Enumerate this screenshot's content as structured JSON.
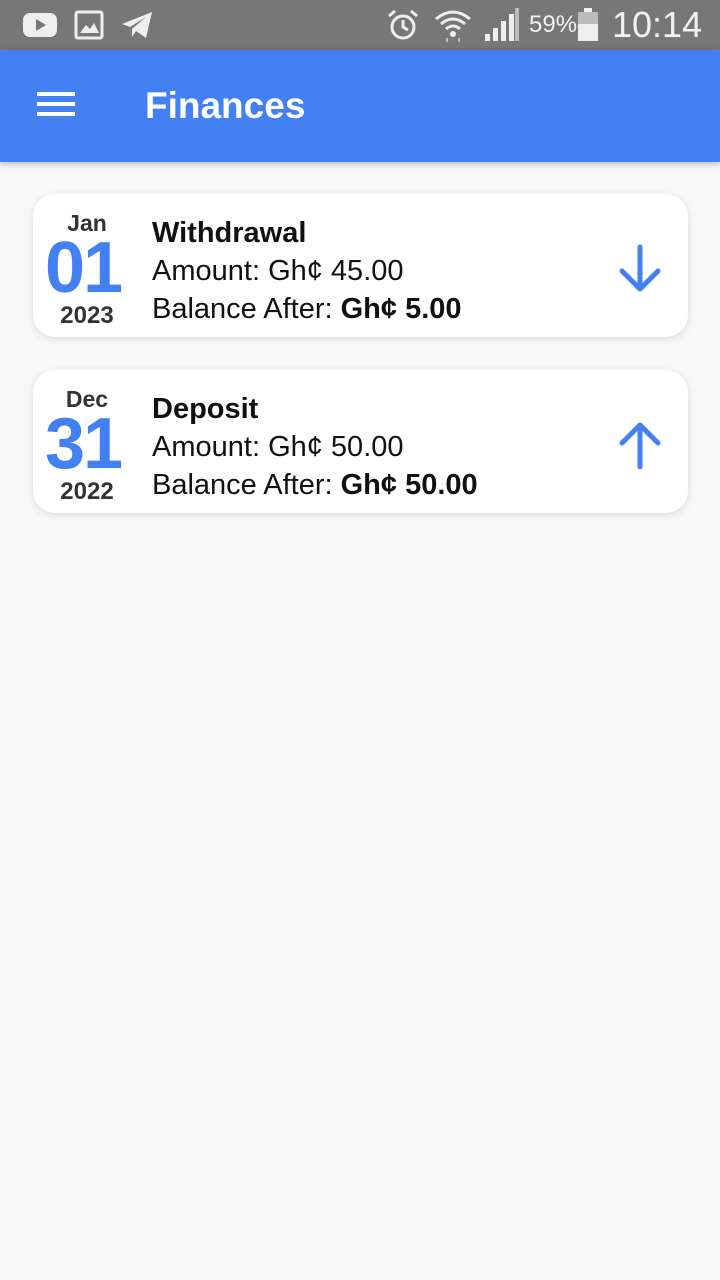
{
  "status_bar": {
    "icons_left": [
      "youtube-icon",
      "image-icon",
      "telegram-icon"
    ],
    "icons_right": [
      "alarm-icon",
      "wifi-icon",
      "signal-icon",
      "battery-icon"
    ],
    "battery_percent": "59%",
    "time": "10:14",
    "bar_color": "#777777"
  },
  "app_bar": {
    "title": "Finances",
    "menu_icon": "hamburger-menu-icon",
    "color": "#4280f4"
  },
  "transactions": [
    {
      "month": "Jan",
      "day": "01",
      "year": "2023",
      "type": "Withdrawal",
      "amount_label": "Amount: ",
      "amount": "Gh¢ 45.00",
      "balance_label": "Balance After: ",
      "balance": "Gh¢ 5.00",
      "direction_icon": "arrow-down-icon"
    },
    {
      "month": "Dec",
      "day": "31",
      "year": "2022",
      "type": "Deposit",
      "amount_label": "Amount: ",
      "amount": "Gh¢ 50.00",
      "balance_label": "Balance After: ",
      "balance": "Gh¢ 50.00",
      "direction_icon": "arrow-up-icon"
    }
  ],
  "colors": {
    "accent": "#4280f4",
    "background": "#f8f8f8",
    "card": "#ffffff"
  }
}
